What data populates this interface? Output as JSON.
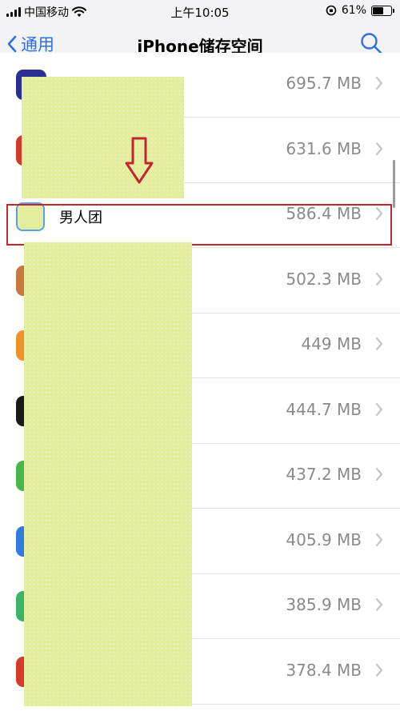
{
  "status_bar": {
    "carrier": "中国移动",
    "time": "上午10:05",
    "battery_percent": "61%",
    "battery_level": 0.61
  },
  "nav": {
    "back_label": "通用",
    "title": "iPhone储存空间"
  },
  "rows": [
    {
      "name": "",
      "size": "695.7 MB",
      "icon_color": "#2b2f8f"
    },
    {
      "name": "",
      "size": "631.6 MB",
      "icon_color": "#d43a2a"
    },
    {
      "name": "男人团",
      "size": "586.4 MB",
      "icon_color": "#5aa0e8"
    },
    {
      "name": "",
      "size": "502.3 MB",
      "icon_color": "#c8783a"
    },
    {
      "name": "",
      "size": "449 MB",
      "icon_color": "#f0922a"
    },
    {
      "name": "",
      "size": "444.7 MB",
      "icon_color": "#1a1a1a"
    },
    {
      "name": "",
      "size": "437.2 MB",
      "icon_color": "#4ab54a"
    },
    {
      "name": "",
      "size": "405.9 MB",
      "icon_color": "#2f7be0"
    },
    {
      "name": "",
      "size": "385.9 MB",
      "icon_color": "#3db36a"
    },
    {
      "name": "",
      "size": "378.4 MB",
      "icon_color": "#d63a2a"
    }
  ],
  "colors": {
    "accent": "#2f6fe0",
    "highlight": "#c3262f",
    "redaction": "#e4ec9e"
  }
}
